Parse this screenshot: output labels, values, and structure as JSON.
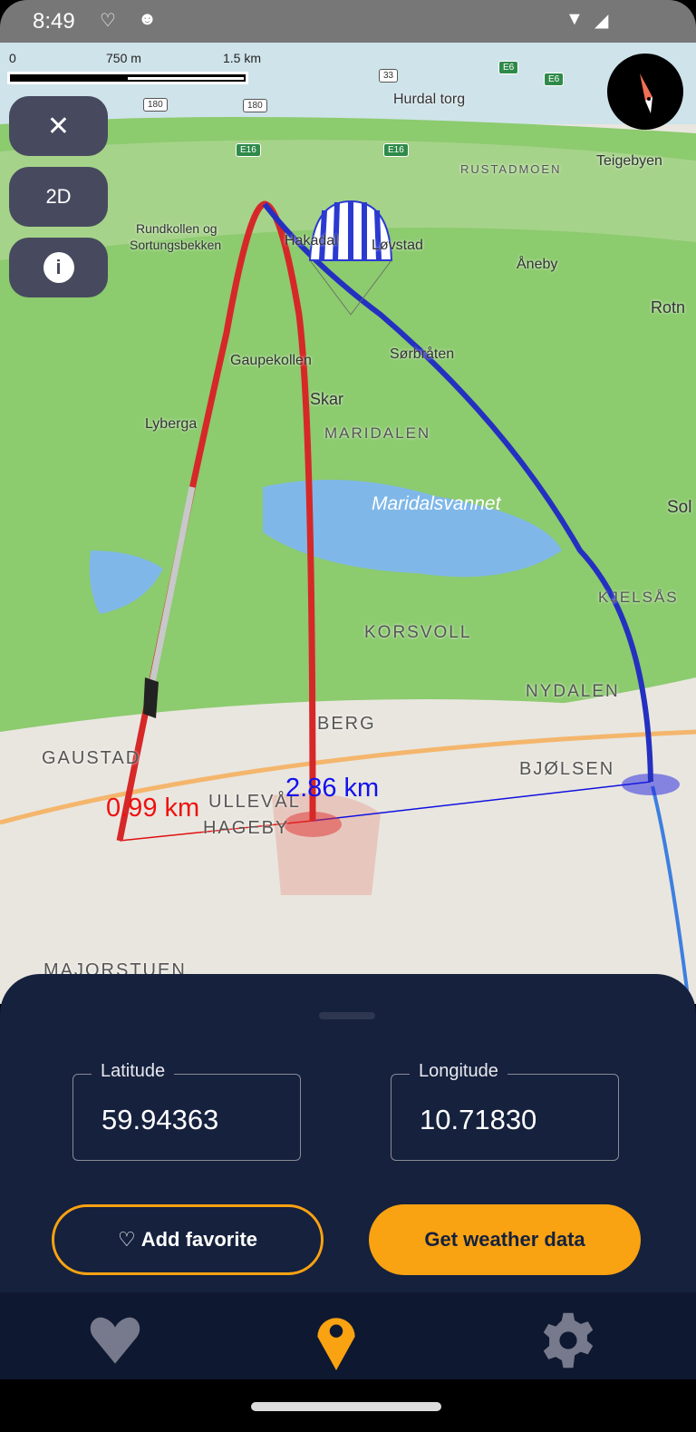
{
  "status_bar": {
    "time": "8:49"
  },
  "map": {
    "scale": {
      "zero": "0",
      "mid": "750 m",
      "end": "1.5 km"
    },
    "road_shields": [
      "180",
      "180",
      "33",
      "E16",
      "E16",
      "E6",
      "E6"
    ],
    "places": {
      "hurdal": "Hurdal torg",
      "rustadmoen": "RUSTADMOEN",
      "teigebyen": "Teigebyen",
      "rundkollen1": "Rundkollen og",
      "rundkollen2": "Sortungsbekken",
      "hakadal": "Hakadal",
      "lovstad": "Løvstad",
      "aneby": "Åneby",
      "rotn": "Rotn",
      "gaupekollen": "Gaupekollen",
      "sorbraten": "Sørbråten",
      "skar": "Skar",
      "lyberga": "Lyberga",
      "maridalen": "MARIDALEN",
      "maridalsvannet": "Maridalsvannet",
      "korsvoll": "KORSVOLL",
      "kjelsas": "KJELSÅS",
      "nydalen": "NYDALEN",
      "berg": "BERG",
      "gaustad": "GAUSTAD",
      "bjolsen": "BJØLSEN",
      "ulleval1": "ULLEVÅL",
      "ulleval2": "HAGEBY",
      "majorstuen": "MAJORSTUEN",
      "sol": "Sol"
    },
    "distance_red": "0.99 km",
    "distance_blue": "2.86 km",
    "colors": {
      "red_path": "#d62828",
      "blue_path": "#2430c0"
    }
  },
  "controls": {
    "close_icon": "close-icon",
    "mode": "2D",
    "info_icon": "info-icon"
  },
  "sheet": {
    "latitude_label": "Latitude",
    "latitude_value": "59.94363",
    "longitude_label": "Longitude",
    "longitude_value": "10.71830",
    "add_favorite": "Add favorite",
    "get_weather": "Get weather data",
    "accent": "#f9a212"
  },
  "bottom_nav": {
    "items": [
      {
        "icon": "heart-icon",
        "active": false
      },
      {
        "icon": "map-pin-icon",
        "active": true
      },
      {
        "icon": "gear-icon",
        "active": false
      }
    ]
  }
}
